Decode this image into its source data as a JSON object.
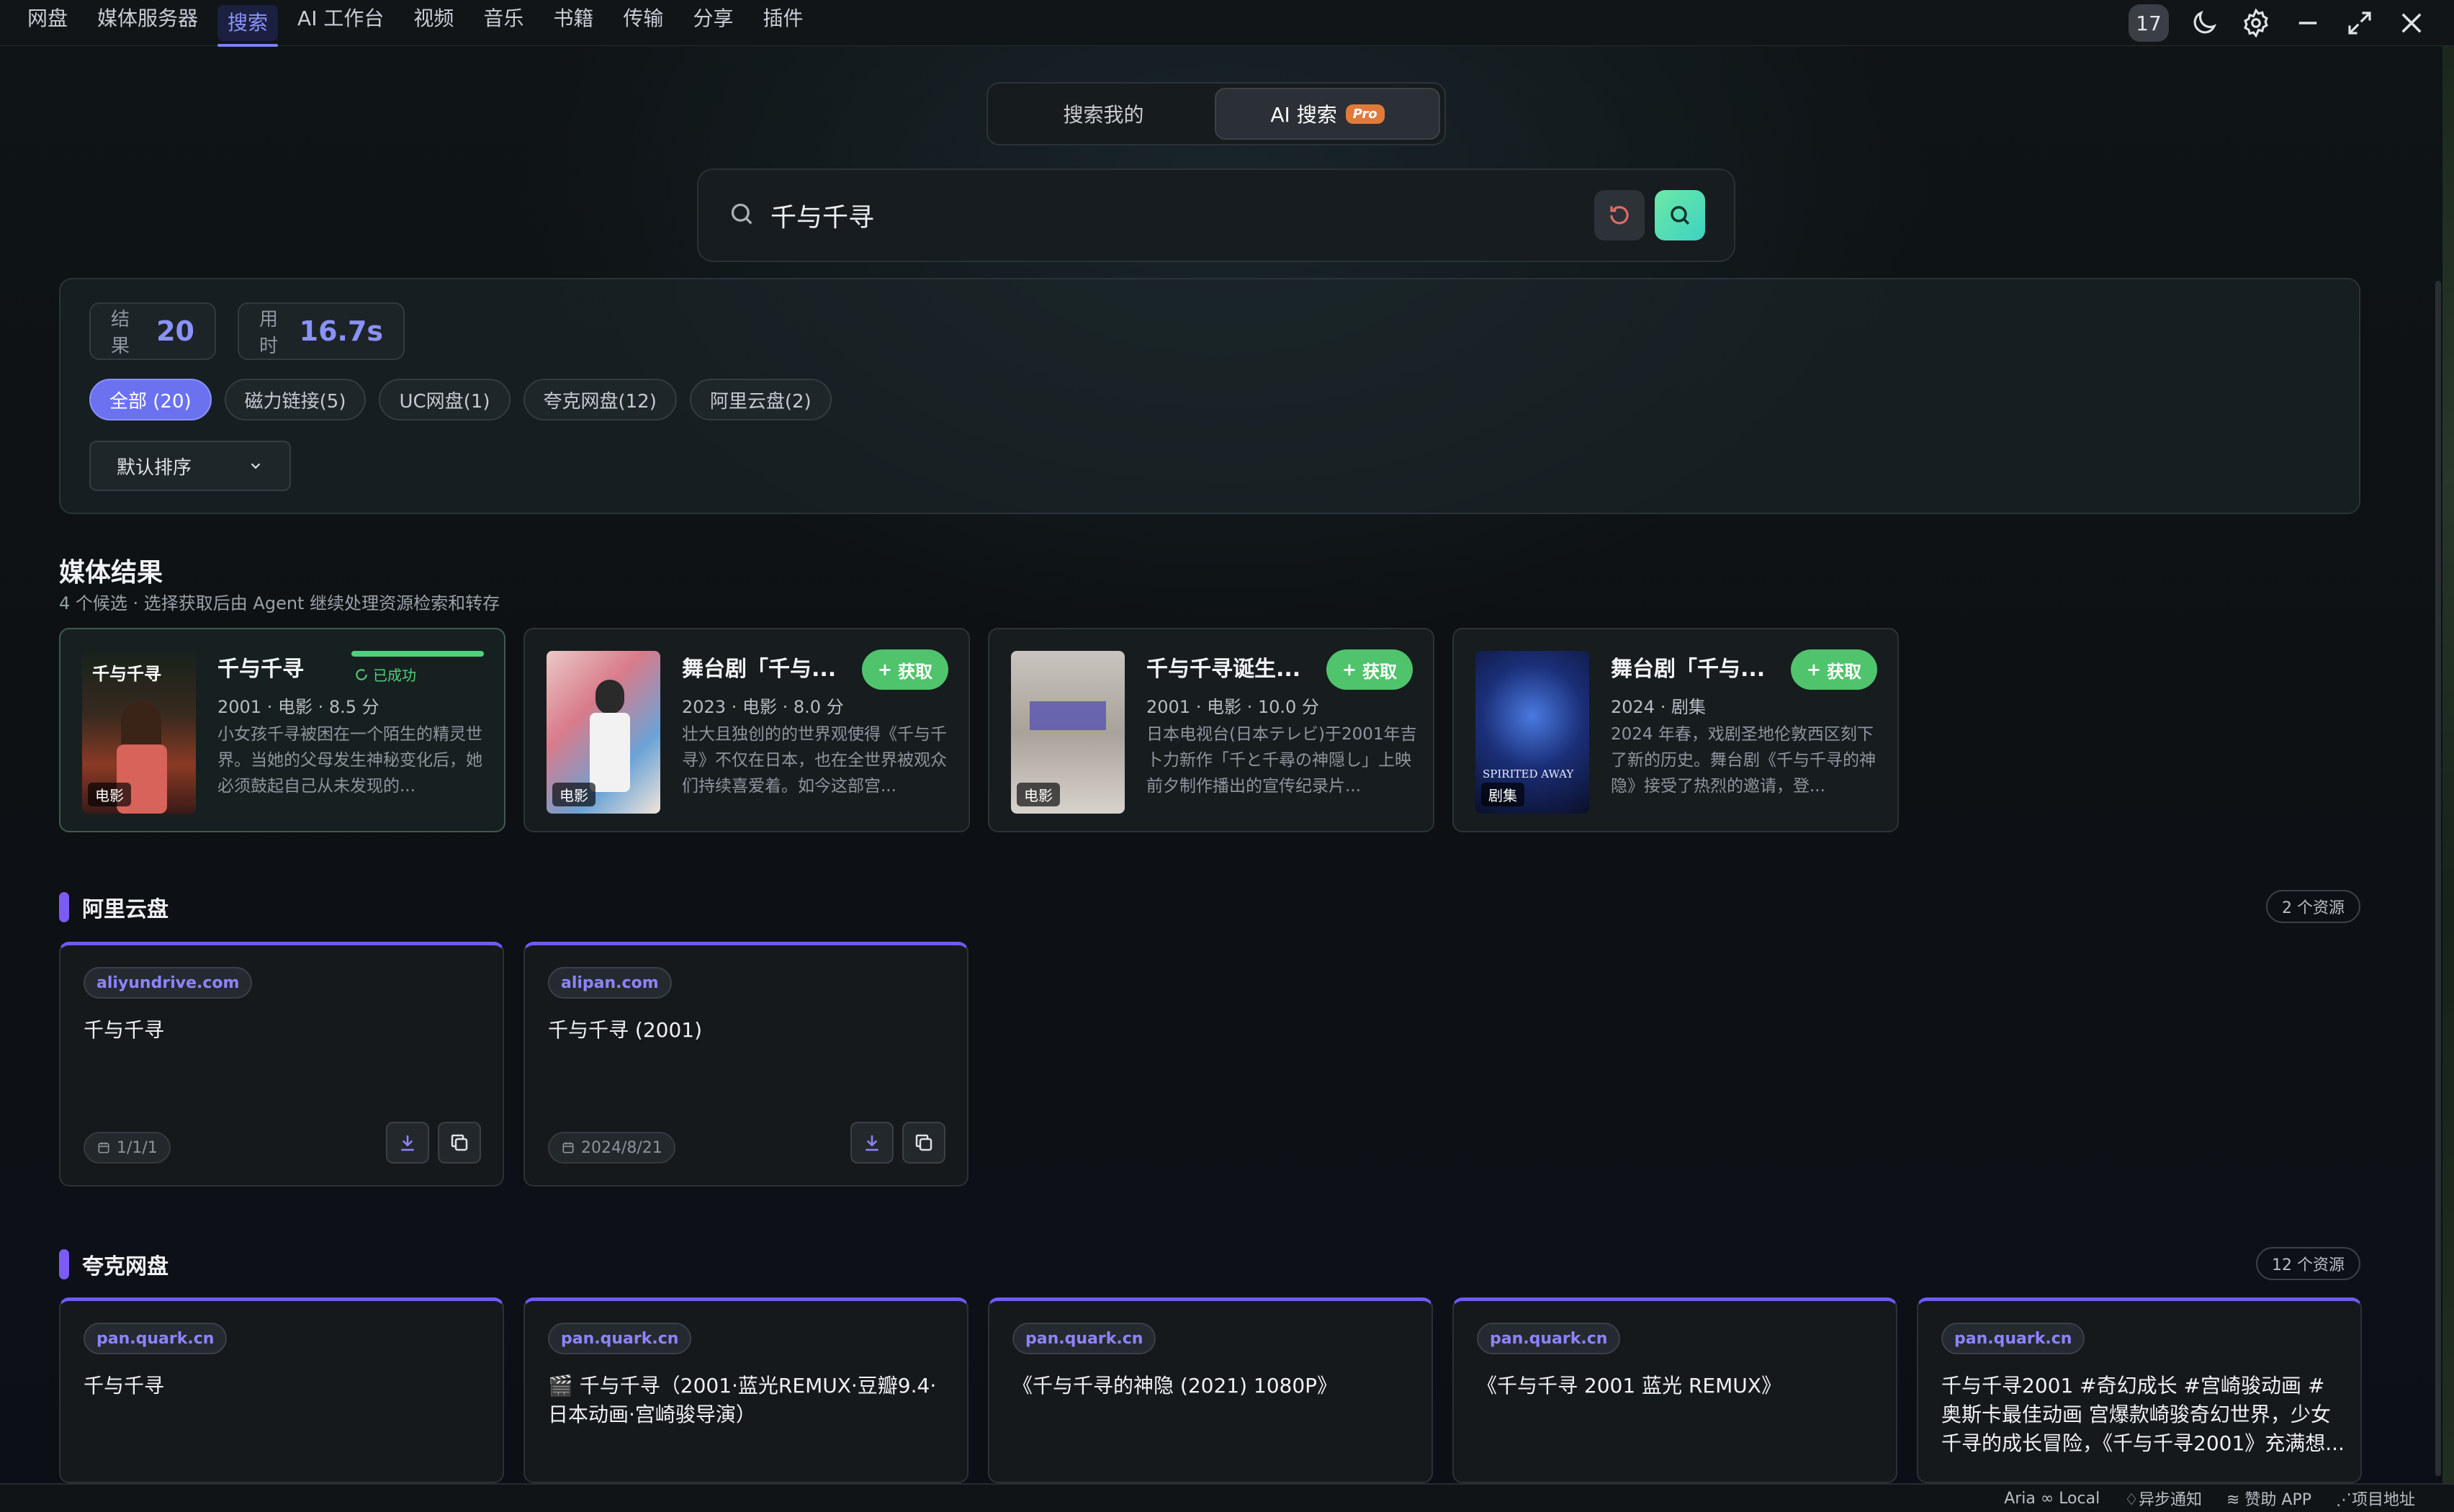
{
  "nav": {
    "items": [
      "网盘",
      "媒体服务器",
      "搜索",
      "AI 工作台",
      "视频",
      "音乐",
      "书籍",
      "传输",
      "分享",
      "插件"
    ],
    "active_index": 2,
    "badge_count": "17"
  },
  "mode": {
    "left": "搜索我的",
    "right": "AI 搜索",
    "pro": "Pro"
  },
  "search": {
    "query": "千与千寻"
  },
  "stats": {
    "results_label": "结果",
    "results_value": "20",
    "time_label": "用时",
    "time_value": "16.7s"
  },
  "filters": [
    "全部 (20)",
    "磁力链接(5)",
    "UC网盘(1)",
    "夸克网盘(12)",
    "阿里云盘(2)"
  ],
  "sort": {
    "selected": "默认排序"
  },
  "media": {
    "title": "媒体结果",
    "subtitle": "4 个候选 · 选择获取后由 Agent 继续处理资源检索和转存",
    "cards": [
      {
        "title": "千与千寻",
        "meta": "2001 · 电影 · 8.5 分",
        "desc": "小女孩千寻被困在一个陌生的精灵世界。当她的父母发生神秘变化后，她必须鼓起自己从未发现的...",
        "tag": "电影",
        "status": "已成功"
      },
      {
        "title": "舞台剧「千与...",
        "meta": "2023 · 电影 · 8.0 分",
        "desc": "壮大且独创的的世界观使得《千与千寻》不仅在日本，也在全世界被观众们持续喜爱着。如今这部宫...",
        "tag": "电影",
        "button": "获取"
      },
      {
        "title": "千与千寻诞生...",
        "meta": "2001 · 电影 · 10.0 分",
        "desc": "日本电视台(日本テレビ)于2001年吉卜力新作「千と千尋の神隠し」上映前夕制作播出的宣传纪录片...",
        "tag": "电影",
        "button": "获取"
      },
      {
        "title": "舞台剧「千与...",
        "meta": "2024 · 剧集",
        "desc": "2024 年春，戏剧圣地伦敦西区刻下了新的历史。舞台剧《千与千寻的神隐》接受了热烈的邀请，登...",
        "tag": "剧集",
        "button": "获取"
      }
    ]
  },
  "aliyun": {
    "name": "阿里云盘",
    "count": "2 个资源",
    "items": [
      {
        "domain": "aliyundrive.com",
        "title": "千与千寻",
        "date": "1/1/1"
      },
      {
        "domain": "alipan.com",
        "title": "千与千寻 (2001)",
        "date": "2024/8/21"
      }
    ]
  },
  "quark": {
    "name": "夸克网盘",
    "count": "12 个资源",
    "items": [
      {
        "domain": "pan.quark.cn",
        "title": "千与千寻"
      },
      {
        "domain": "pan.quark.cn",
        "title": "🎬 千与千寻（2001·蓝光REMUX·豆瓣9.4·日本动画·宫崎骏导演）"
      },
      {
        "domain": "pan.quark.cn",
        "title": "《千与千寻的神隐 (2021) 1080P》"
      },
      {
        "domain": "pan.quark.cn",
        "title": "《千与千寻 2001 蓝光 REMUX》"
      },
      {
        "domain": "pan.quark.cn",
        "title": "千与千寻2001 #奇幻成长 #宫崎骏动画 #奥斯卡最佳动画 宫爆款崎骏奇幻世界，少女千寻的成长冒险，《千与千寻2001》充满想..."
      }
    ]
  },
  "footer": {
    "aria": "Aria ∞ Local",
    "notify": "异步通知",
    "app": "赞助 APP",
    "project": "项目地址"
  }
}
